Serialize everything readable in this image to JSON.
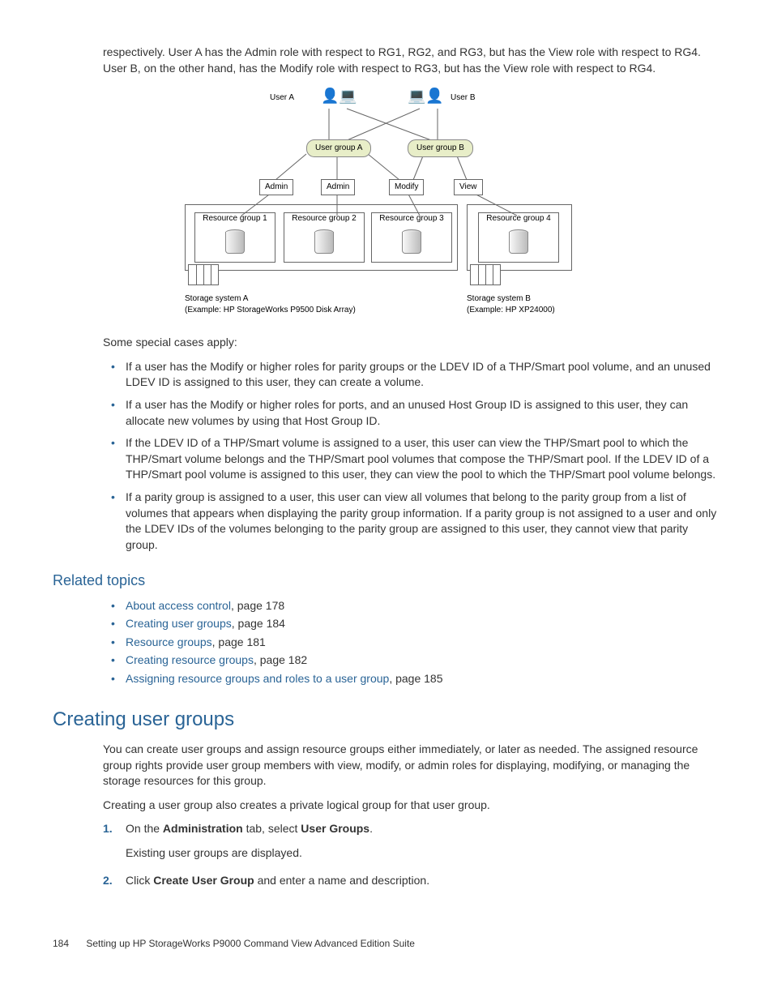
{
  "intro_paragraph": "respectively. User A has the Admin role with respect to RG1, RG2, and RG3, but has the View role with respect to RG4. User B, on the other hand, has the Modify role with respect to RG3, but has the View role with respect to RG4.",
  "diagram": {
    "user_a": "User A",
    "user_b": "User B",
    "ug_a": "User group A",
    "ug_b": "User group B",
    "role_admin": "Admin",
    "role_modify": "Modify",
    "role_view": "View",
    "rg1": "Resource group 1",
    "rg2": "Resource group 2",
    "rg3": "Resource group 3",
    "rg4": "Resource group 4",
    "storage_a": "Storage system A",
    "storage_a_ex": "(Example: HP StorageWorks P9500 Disk Array)",
    "storage_b": "Storage system B",
    "storage_b_ex": "(Example: HP XP24000)"
  },
  "special_intro": "Some special cases apply:",
  "special_cases": [
    "If a user has the Modify or higher roles for parity groups or the LDEV ID of a THP/Smart pool volume, and an unused LDEV ID is assigned to this user, they can create a volume.",
    "If a user has the Modify or higher roles for ports, and an unused Host Group ID is assigned to this user, they can allocate new volumes by using that Host Group ID.",
    "If the LDEV ID of a THP/Smart volume is assigned to a user, this user can view the THP/Smart pool to which the THP/Smart volume belongs and the THP/Smart pool volumes that compose the THP/Smart pool. If the LDEV ID of a THP/Smart pool volume is assigned to this user, they can view the pool to which the THP/Smart pool volume belongs.",
    "If a parity group is assigned to a user, this user can view all volumes that belong to the parity group from a list of volumes that appears when displaying the parity group information. If a parity group is not assigned to a user and only the LDEV IDs of the volumes belonging to the parity group are assigned to this user, they cannot view that parity group."
  ],
  "related_heading": "Related topics",
  "related": [
    {
      "text": "About access control",
      "page": ", page 178"
    },
    {
      "text": "Creating user groups",
      "page": ", page 184"
    },
    {
      "text": "Resource groups",
      "page": ", page 181"
    },
    {
      "text": "Creating resource groups",
      "page": ", page 182"
    },
    {
      "text": "Assigning resource groups and roles to a user group",
      "page": ", page 185"
    }
  ],
  "section_heading": "Creating user groups",
  "section_p1": "You can create user groups and assign resource groups either immediately, or later as needed. The assigned resource group rights provide user group members with view, modify, or admin roles for displaying, modifying, or managing the storage resources for this group.",
  "section_p2": "Creating a user group also creates a private logical group for that user group.",
  "steps": {
    "s1_num": "1.",
    "s1_a": "On the ",
    "s1_b": "Administration",
    "s1_c": " tab, select ",
    "s1_d": "User Groups",
    "s1_e": ".",
    "s1_sub": "Existing user groups are displayed.",
    "s2_num": "2.",
    "s2_a": "Click ",
    "s2_b": "Create User Group",
    "s2_c": " and enter a name and description."
  },
  "footer": {
    "page": "184",
    "title": "Setting up HP StorageWorks P9000 Command View Advanced Edition Suite"
  }
}
